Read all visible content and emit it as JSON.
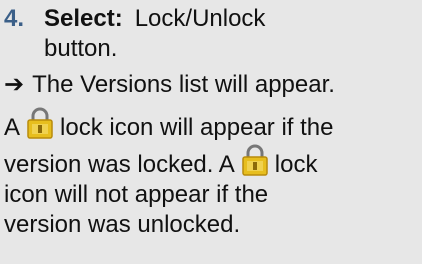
{
  "step": {
    "number": "4.",
    "label": "Select:",
    "text_1": "Lock/Unlock",
    "text_2": "button."
  },
  "result": {
    "arrow": "➔",
    "text": "The Versions list will appear."
  },
  "paragraph": {
    "line1_a": "A",
    "line1_b": "lock icon will appear if the",
    "line2_a": "version was locked.  A",
    "line2_b": "lock",
    "line3": "icon will not appear if the",
    "line4": "version was unlocked."
  },
  "icons": {
    "lock": "lock-icon"
  },
  "colors": {
    "background": "#e7e7e7",
    "step_number": "#3b5f88",
    "lock_body": "#e7be1e",
    "lock_shackle": "#777777"
  }
}
